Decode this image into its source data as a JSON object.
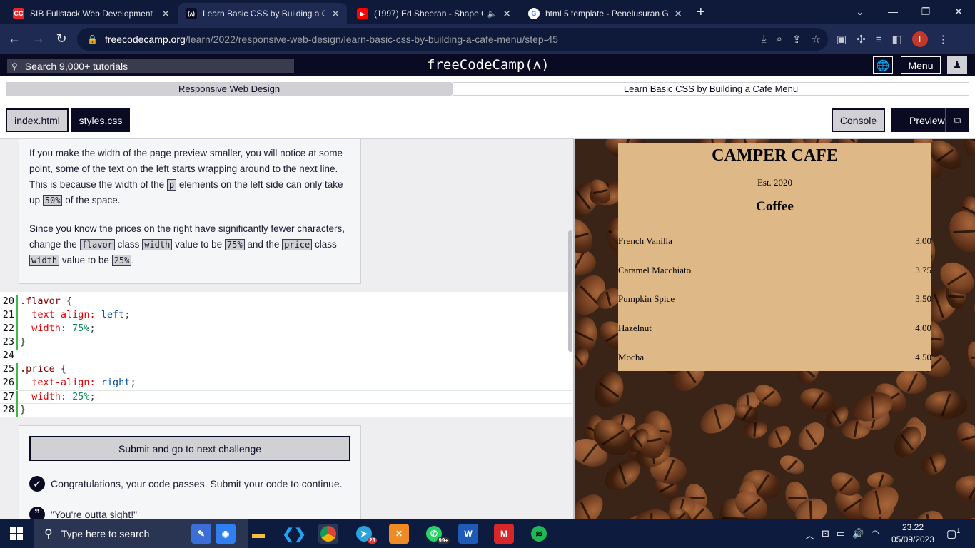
{
  "browser": {
    "tabs": [
      {
        "title": "SIB Fullstack Web Development |",
        "favicon": "CC",
        "favicon_color": "#e0282e",
        "active": false
      },
      {
        "title": "Learn Basic CSS by Building a Caf",
        "favicon": "(ʌ)",
        "favicon_color": "#0a0a23",
        "active": true
      },
      {
        "title": "(1997) Ed Sheeran - Shape O",
        "favicon": "▶",
        "favicon_color": "#ff0000",
        "active": false,
        "audio_icon": "speaker-icon"
      },
      {
        "title": "html 5 template - Penelusuran G",
        "favicon": "G",
        "favicon_color": "#ffffff",
        "active": false
      }
    ],
    "new_tab_glyph": "+",
    "url_host": "freecodecamp.org",
    "url_path": "/learn/2022/responsive-web-design/learn-basic-css-by-building-a-cafe-menu/step-45",
    "profile_initial": "I",
    "profile_color": "#c0392b"
  },
  "fcc_nav": {
    "search_placeholder": "Search 9,000+ tutorials",
    "brand": "freeCodeCamp(ʌ)",
    "menu_label": "Menu"
  },
  "breadcrumb": {
    "superblock": "Responsive Web Design",
    "block": "Learn Basic CSS by Building a Cafe Menu"
  },
  "editor_tabs": {
    "file1": "index.html",
    "file2": "styles.css",
    "console": "Console",
    "preview": "Preview"
  },
  "instructions": {
    "p1_a": "If you make the width of the page preview smaller, you will notice at some point, some of the text on the left starts wrapping around to the next line. This is because the width of the ",
    "p1_code1": "p",
    "p1_b": " elements on the left side can only take up ",
    "p1_code2": "50%",
    "p1_c": " of the space.",
    "p2_a": "Since you know the prices on the right have significantly fewer characters, change the ",
    "p2_code1": "flavor",
    "p2_b": " class ",
    "p2_code2": "width",
    "p2_c": " value to be ",
    "p2_code3": "75%",
    "p2_d": " and the ",
    "p2_code4": "price",
    "p2_e": " class ",
    "p2_code5": "width",
    "p2_f": " value to be ",
    "p2_code6": "25%",
    "p2_g": "."
  },
  "code": {
    "lines": [
      {
        "num": "20",
        "sel": ".flavor",
        "rest": " {"
      },
      {
        "num": "21",
        "prop": "  text-align:",
        "val": " left",
        "end": ";"
      },
      {
        "num": "22",
        "prop": "  width:",
        "val": " 75%",
        "end": ";"
      },
      {
        "num": "23",
        "plain": "}"
      },
      {
        "num": "24",
        "plain": ""
      },
      {
        "num": "25",
        "sel": ".price",
        "rest": " {"
      },
      {
        "num": "26",
        "prop": "  text-align:",
        "val": " right",
        "end": ";"
      },
      {
        "num": "27",
        "prop": "  width:",
        "val": " 25%",
        "end": ";"
      },
      {
        "num": "28",
        "plain": "}"
      }
    ]
  },
  "actions": {
    "submit_label": "Submit and go to next challenge",
    "pass_message": "Congratulations, your code passes. Submit your code to continue.",
    "quote": "\"You're outta sight!\""
  },
  "preview_page": {
    "title": "CAMPER CAFE",
    "est": "Est. 2020",
    "section": "Coffee",
    "items": [
      {
        "flavor": "French Vanilla",
        "price": "3.00"
      },
      {
        "flavor": "Caramel Macchiato",
        "price": "3.75"
      },
      {
        "flavor": "Pumpkin Spice",
        "price": "3.50"
      },
      {
        "flavor": "Hazelnut",
        "price": "4.00"
      },
      {
        "flavor": "Mocha",
        "price": "4.50"
      }
    ],
    "card_color": "#deb887"
  },
  "taskbar": {
    "search_placeholder": "Type here to search",
    "time": "23.22",
    "date": "05/09/2023",
    "telegram_badge": "23",
    "whatsapp_badge": "99+",
    "notification_count": "1"
  }
}
